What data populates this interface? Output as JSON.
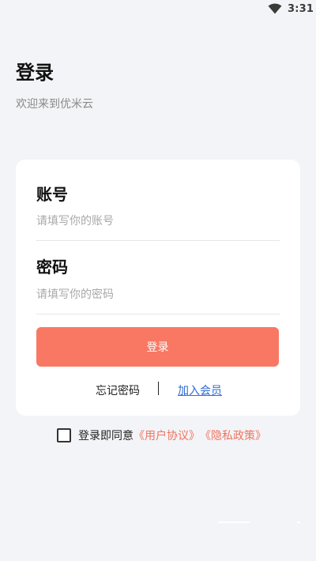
{
  "status_bar": {
    "time": "3:31",
    "wifi_icon": "wifi-icon"
  },
  "header": {
    "title": "登录",
    "subtitle": "欢迎来到优米云"
  },
  "form": {
    "account_label": "账号",
    "account_placeholder": "请填写你的账号",
    "account_value": "",
    "password_label": "密码",
    "password_placeholder": "请填写你的密码",
    "password_value": "",
    "login_button_label": "登录",
    "forgot_password": "忘记密码",
    "join_member": "加入会员"
  },
  "agreement": {
    "checked": false,
    "prefix": "登录即同意",
    "user_agreement": "《用户协议》",
    "privacy_policy": "《隐私政策》"
  },
  "colors": {
    "background": "#f3f4f7",
    "card": "#ffffff",
    "accent": "#f97863",
    "link_blue": "#2f6bd6",
    "agreement_link": "#f0735f"
  }
}
